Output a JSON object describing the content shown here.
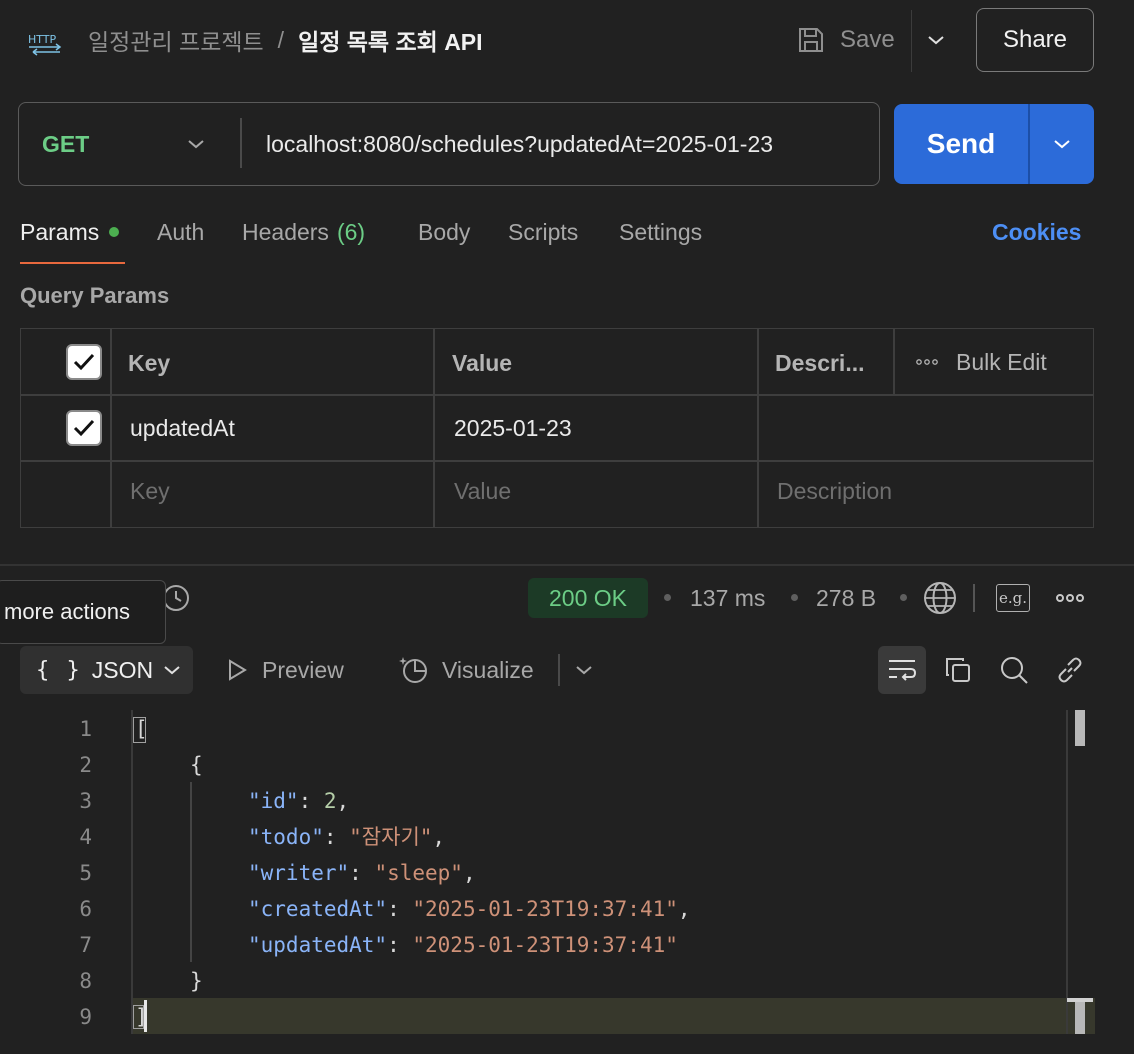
{
  "header": {
    "collection": "일정관리 프로젝트",
    "separator": "/",
    "request_name": "일정 목록 조회 API",
    "save_label": "Save",
    "share_label": "Share",
    "http_icon": "HTTP"
  },
  "request": {
    "method": "GET",
    "url": "localhost:8080/schedules?updatedAt=2025-01-23",
    "send_label": "Send"
  },
  "tabs": {
    "params": "Params",
    "auth": "Auth",
    "headers": "Headers",
    "headers_count": "(6)",
    "body": "Body",
    "scripts": "Scripts",
    "settings": "Settings",
    "cookies": "Cookies"
  },
  "query_params": {
    "title": "Query Params",
    "headers": {
      "key": "Key",
      "value": "Value",
      "description": "Descri...",
      "bulk_edit": "Bulk Edit"
    },
    "rows": [
      {
        "checked": true,
        "key": "updatedAt",
        "value": "2025-01-23",
        "description": ""
      }
    ],
    "placeholders": {
      "key": "Key",
      "value": "Value",
      "description": "Description"
    }
  },
  "response": {
    "tooltip": "more actions",
    "status": "200 OK",
    "time": "137 ms",
    "size": "278 B",
    "eg_label": "e.g.",
    "format_label": "JSON",
    "preview_label": "Preview",
    "visualize_label": "Visualize",
    "line_numbers": [
      "1",
      "2",
      "3",
      "4",
      "5",
      "6",
      "7",
      "8",
      "9"
    ],
    "body": {
      "open_bracket": "[",
      "open_brace": "{",
      "id_key": "\"id\"",
      "id_value": "2",
      "todo_key": "\"todo\"",
      "todo_value": "\"잠자기\"",
      "writer_key": "\"writer\"",
      "writer_value": "\"sleep\"",
      "created_key": "\"createdAt\"",
      "created_value": "\"2025-01-23T19:37:41\"",
      "updated_key": "\"updatedAt\"",
      "updated_value": "\"2025-01-23T19:37:41\"",
      "close_brace": "}",
      "close_bracket": "]"
    }
  },
  "colors": {
    "background": "#212121",
    "method_get": "#6ccd86",
    "send_button": "#2c6bd9",
    "active_tab_underline": "#e8693e",
    "cookies_link": "#4d8ff5",
    "status_ok_bg": "#1c3a26",
    "json_key": "#8ab4f8",
    "json_string": "#ce9178"
  },
  "icons": [
    "http-icon",
    "save-icon",
    "chevron-down-icon",
    "history-icon",
    "globe-icon",
    "more-icon",
    "play-icon",
    "visualize-icon",
    "wrap-icon",
    "copy-icon",
    "search-icon",
    "link-icon",
    "checkmark-icon"
  ]
}
